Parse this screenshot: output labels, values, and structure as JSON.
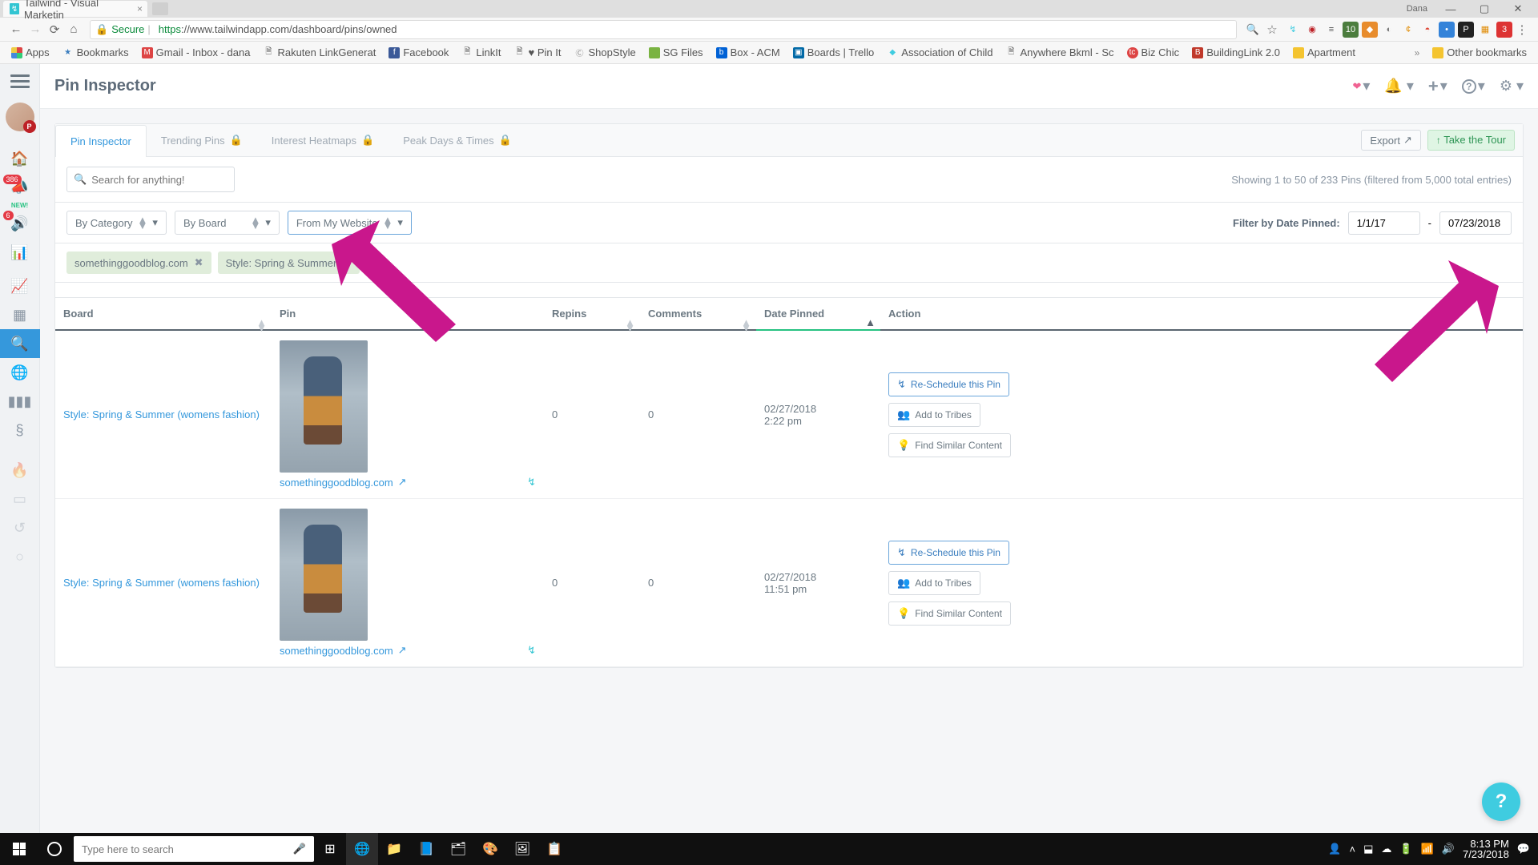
{
  "browser": {
    "tab_title": "Tailwind - Visual Marketin",
    "user": "Dana",
    "secure": "Secure",
    "url_https": "https",
    "url_rest": "://www.tailwindapp.com/dashboard/pins/owned"
  },
  "bookmarks": {
    "apps": "Apps",
    "items": [
      "Bookmarks",
      "Gmail - Inbox - dana",
      "Rakuten LinkGenerat",
      "Facebook",
      "LinkIt",
      "♥ Pin It",
      "ShopStyle",
      "SG Files",
      "Box - ACM",
      "Boards | Trello",
      "Association of Child",
      "Anywhere Bkml - Sc",
      "Biz Chic",
      "BuildingLink 2.0",
      "Apartment"
    ],
    "other": "Other bookmarks"
  },
  "rail": {
    "badge1": "386",
    "new": "NEW!",
    "badge2": "6"
  },
  "header": {
    "title": "Pin Inspector"
  },
  "tabs": {
    "pin_inspector": "Pin Inspector",
    "trending": "Trending Pins",
    "heatmaps": "Interest Heatmaps",
    "peak": "Peak Days & Times",
    "export": "Export",
    "tour": "Take the Tour"
  },
  "search": {
    "placeholder": "Search for anything!"
  },
  "showing": "Showing 1 to 50 of 233 Pins (filtered from 5,000 total entries)",
  "filters": {
    "by_category": "By Category",
    "by_board": "By Board",
    "from_website": "From My Website",
    "date_label": "Filter by Date Pinned:",
    "date_from": "1/1/17",
    "date_sep": "-",
    "date_to": "07/23/2018"
  },
  "chips": {
    "site": "somethinggoodblog.com",
    "board": "Style: Spring & Summer"
  },
  "table": {
    "cols": {
      "board": "Board",
      "pin": "Pin",
      "repins": "Repins",
      "comments": "Comments",
      "date": "Date Pinned",
      "action": "Action"
    },
    "rows": [
      {
        "board": "Style: Spring & Summer (womens fashion)",
        "src": "somethinggoodblog.com",
        "repins": "0",
        "comments": "0",
        "date": "02/27/2018",
        "time": "2:22 pm"
      },
      {
        "board": "Style: Spring & Summer (womens fashion)",
        "src": "somethinggoodblog.com",
        "repins": "0",
        "comments": "0",
        "date": "02/27/2018",
        "time": "11:51 pm"
      }
    ],
    "actions": {
      "reschedule": "Re-Schedule this Pin",
      "tribes": "Add to Tribes",
      "similar": "Find Similar Content"
    }
  },
  "taskbar": {
    "search_ph": "Type here to search",
    "time": "8:13 PM",
    "date": "7/23/2018"
  }
}
